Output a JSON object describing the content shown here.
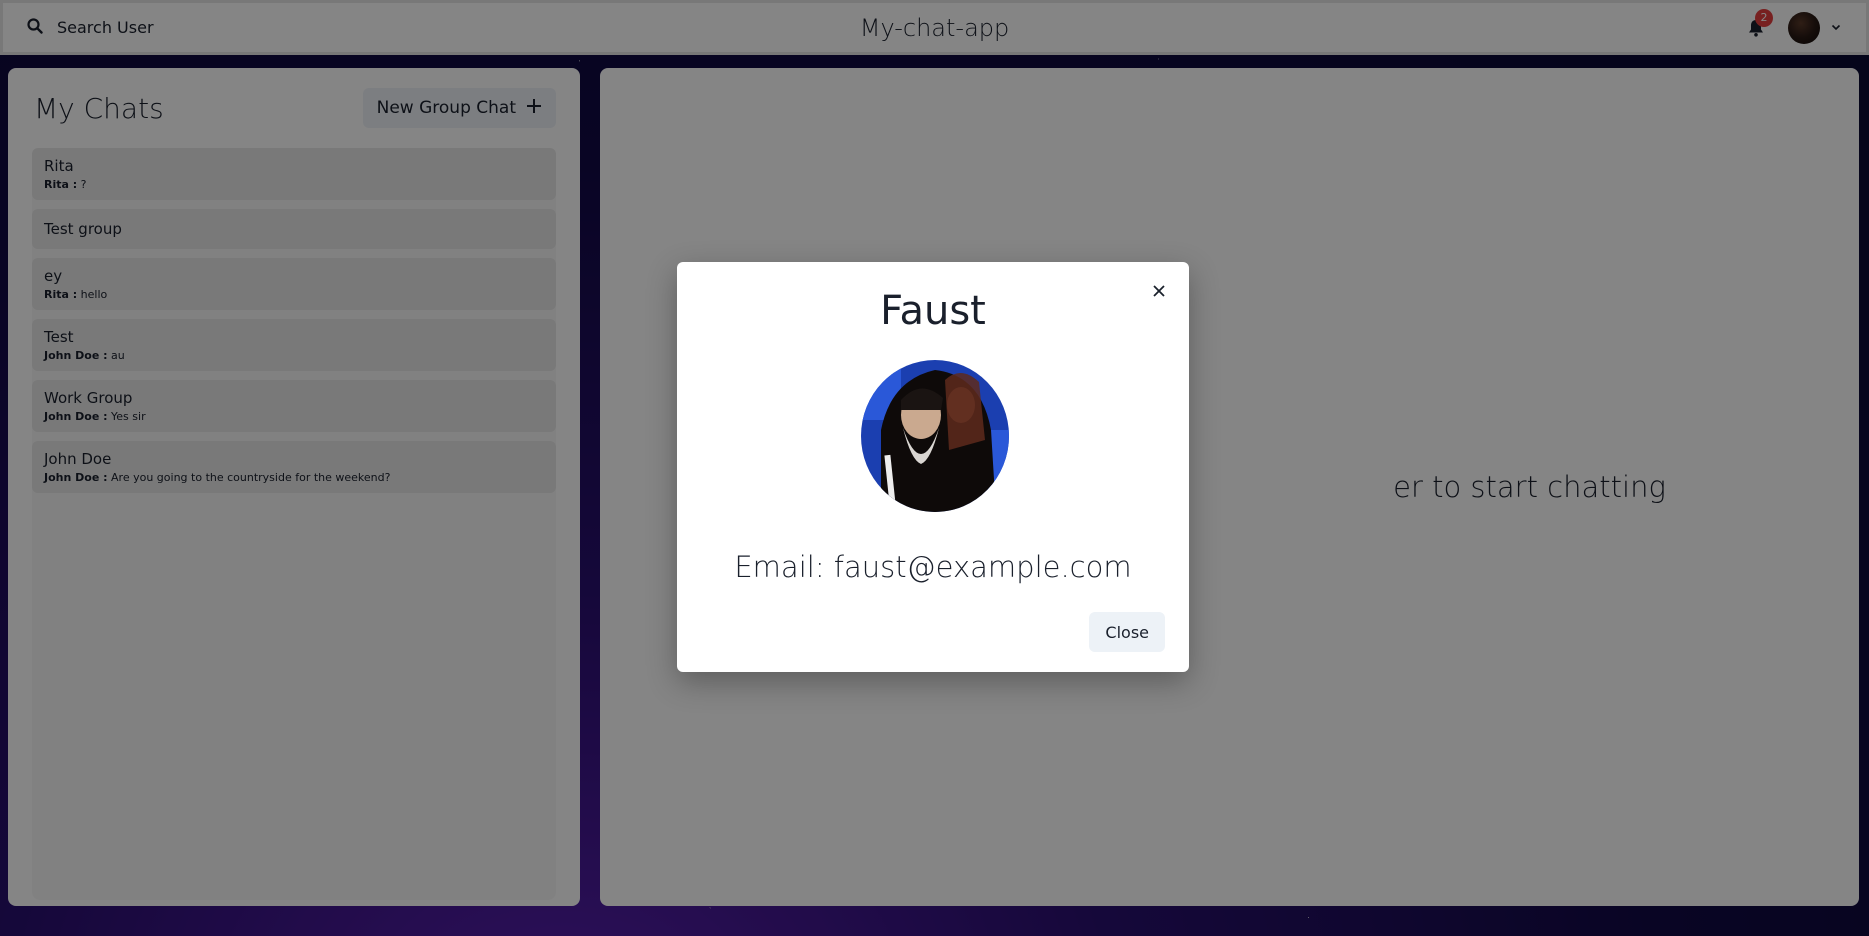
{
  "header": {
    "search_label": "Search User",
    "app_title": "My-chat-app",
    "notification_count": "2"
  },
  "sidebar": {
    "title": "My Chats",
    "new_group_label": "New Group Chat",
    "chats": [
      {
        "name": "Rita",
        "sender": "Rita :",
        "message": "?"
      },
      {
        "name": "Test group",
        "sender": "",
        "message": ""
      },
      {
        "name": "ey",
        "sender": "Rita :",
        "message": "hello"
      },
      {
        "name": "Test",
        "sender": "John Doe :",
        "message": "au"
      },
      {
        "name": "Work Group",
        "sender": "John Doe :",
        "message": "Yes sir"
      },
      {
        "name": "John Doe",
        "sender": "John Doe :",
        "message": "Are you going to the countryside for the weekend?"
      }
    ]
  },
  "main": {
    "placeholder_visible": "er to start chatting"
  },
  "modal": {
    "title": "Faust",
    "email": "Email: faust@example.com",
    "close_label": "Close"
  },
  "colors": {
    "badge": "#e53e3e",
    "button_bg": "#edf2f7",
    "text": "#1a202c"
  }
}
